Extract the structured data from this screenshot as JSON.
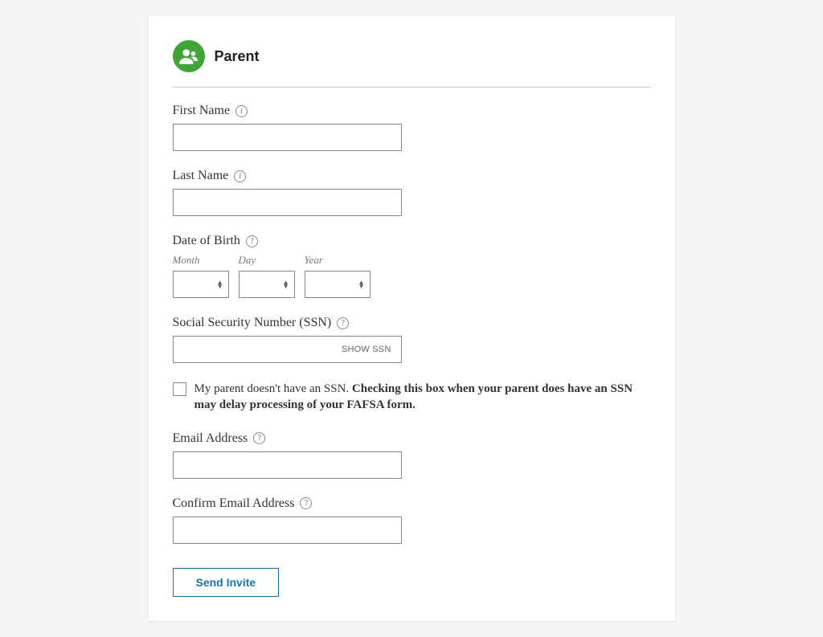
{
  "header": {
    "title": "Parent"
  },
  "firstName": {
    "label": "First Name",
    "value": ""
  },
  "lastName": {
    "label": "Last Name",
    "value": ""
  },
  "dob": {
    "label": "Date of Birth",
    "month": {
      "label": "Month",
      "value": ""
    },
    "day": {
      "label": "Day",
      "value": ""
    },
    "year": {
      "label": "Year",
      "value": ""
    }
  },
  "ssn": {
    "label": "Social Security Number (SSN)",
    "value": "",
    "toggleLabel": "SHOW SSN"
  },
  "noSsn": {
    "textPlain": "My parent doesn't have an SSN. ",
    "textBold": "Checking this box when your parent does have an SSN may delay processing of your FAFSA form."
  },
  "email": {
    "label": "Email Address",
    "value": ""
  },
  "confirmEmail": {
    "label": "Confirm Email Address",
    "value": ""
  },
  "sendInvite": {
    "label": "Send Invite"
  },
  "helpGlyphInfo": "i",
  "helpGlyphQ": "?"
}
